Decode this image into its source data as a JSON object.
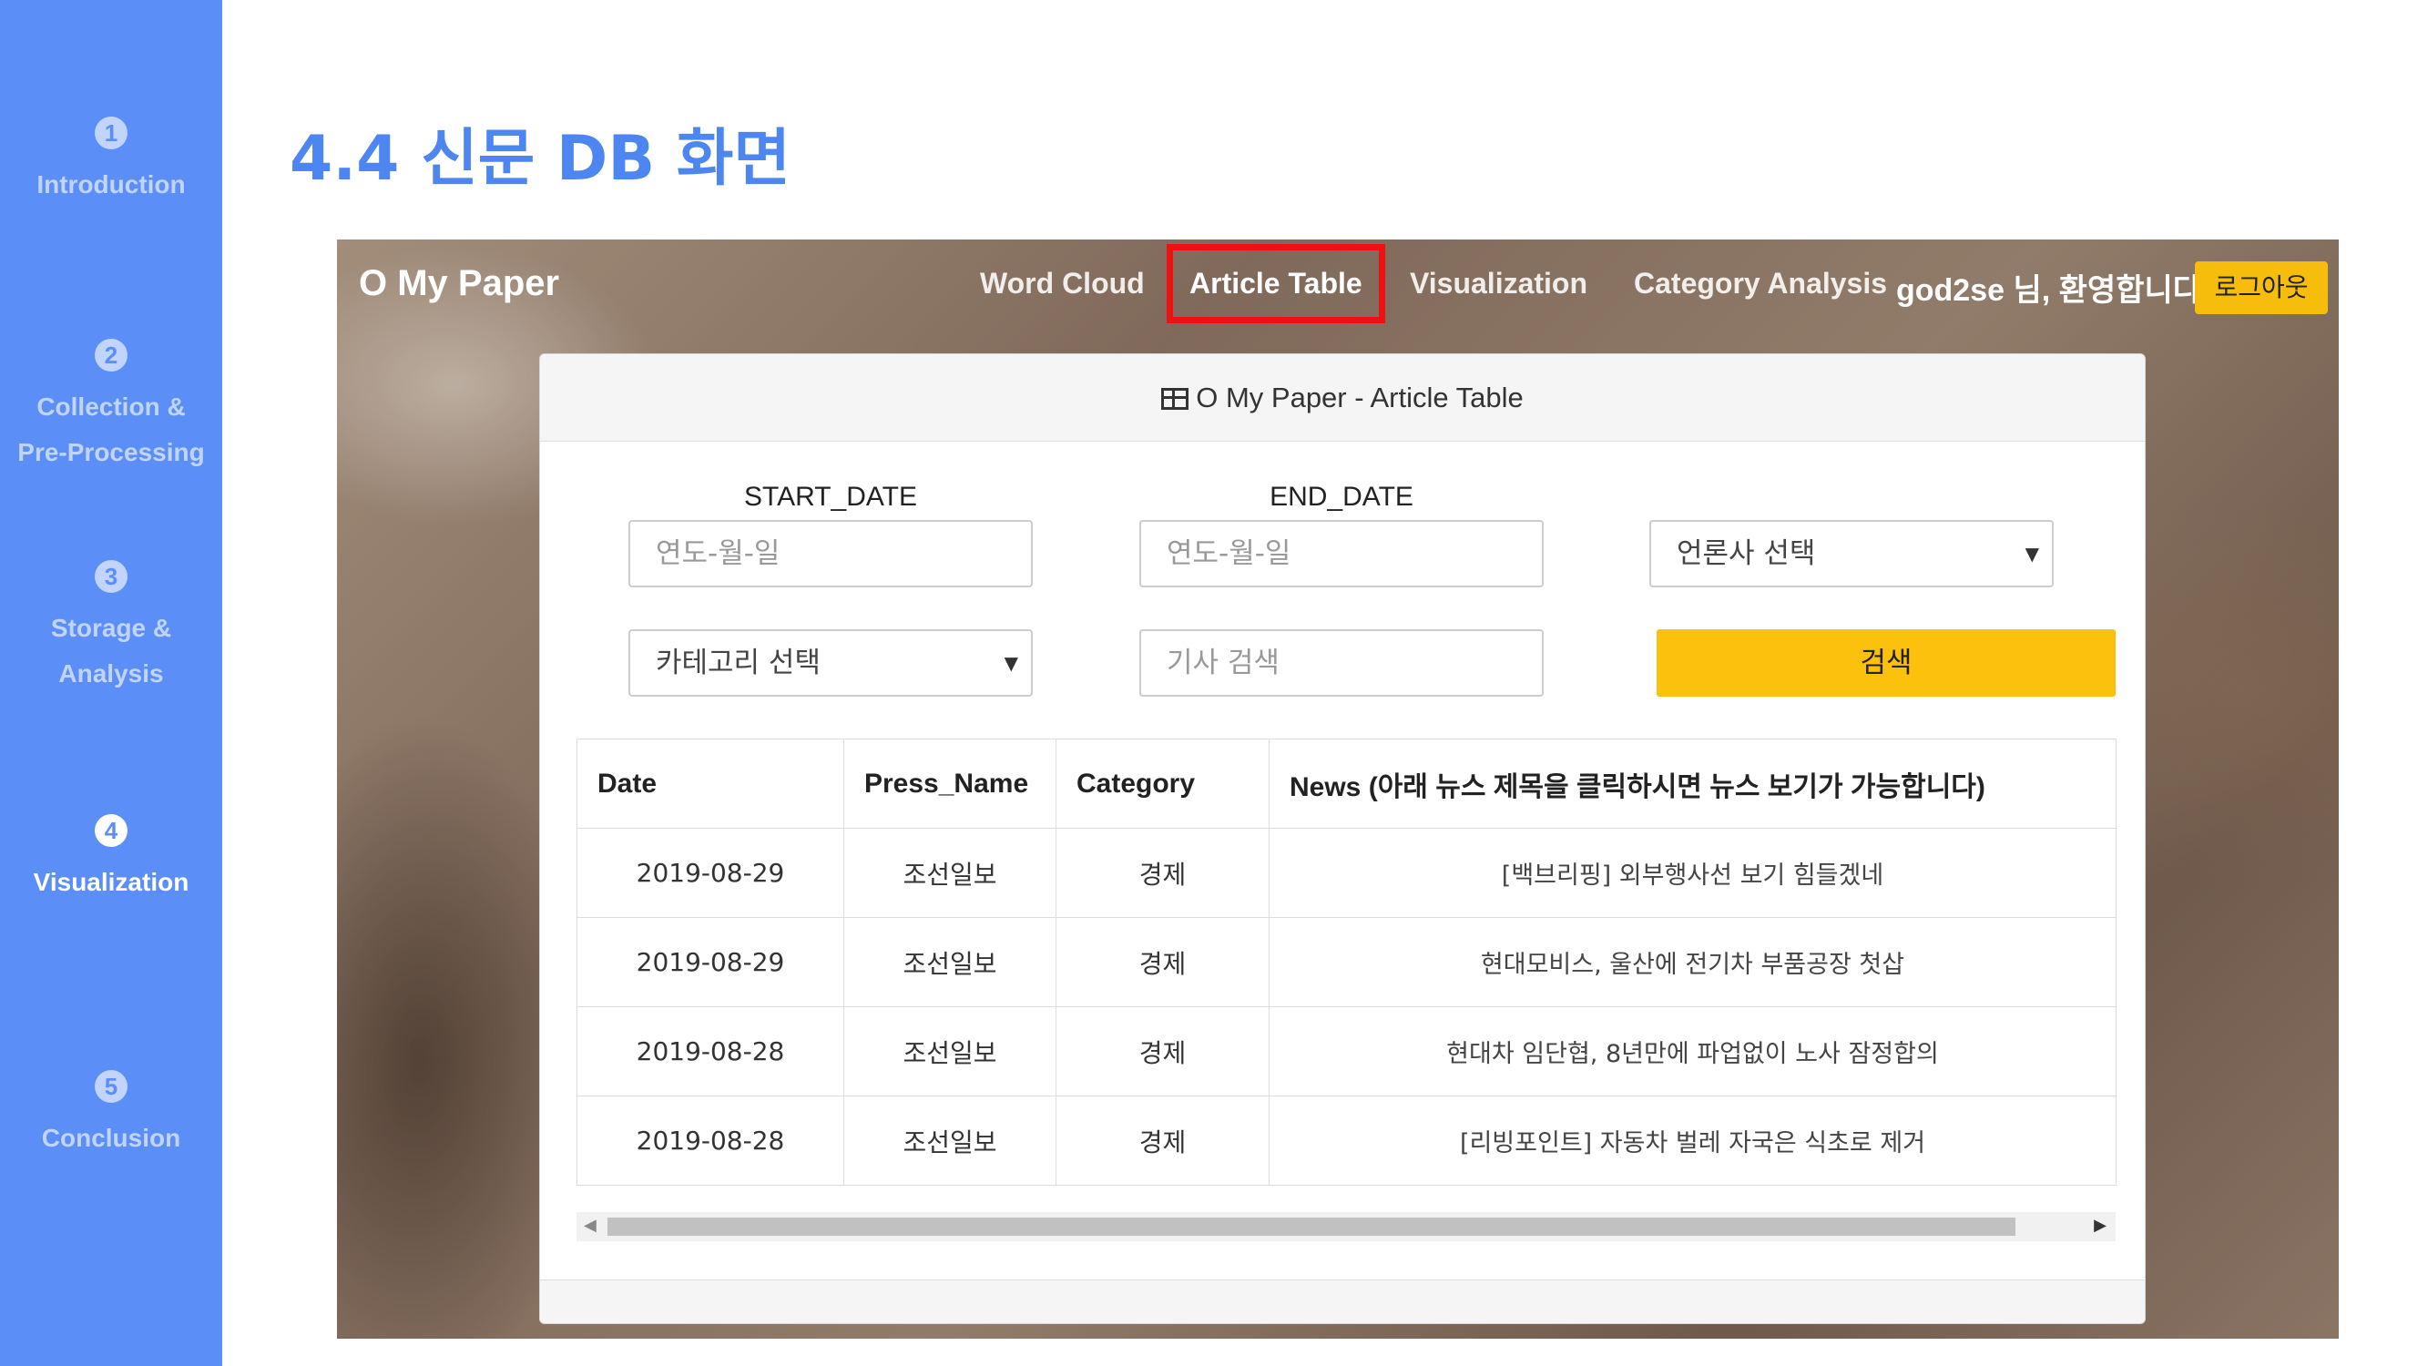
{
  "slide": {
    "title": "4.4 신문 DB 화면",
    "nav": [
      {
        "num": "1",
        "label": "Introduction"
      },
      {
        "num": "2",
        "label": "Collection &\nPre-Processing"
      },
      {
        "num": "3",
        "label": "Storage &\nAnalysis"
      },
      {
        "num": "4",
        "label": "Visualization",
        "active": true
      },
      {
        "num": "5",
        "label": "Conclusion"
      }
    ],
    "accent_color": "#5b8ff7",
    "highlight_color": "#ee1111"
  },
  "app": {
    "brand": "O My Paper",
    "menu": [
      "Word Cloud",
      "Article Table",
      "Visualization",
      "Category Analysis"
    ],
    "active_menu": "Article Table",
    "welcome": "god2se 님, 환영합니다.",
    "logout_label": "로그아웃",
    "panel_title": "O My Paper - Article Table",
    "filters": {
      "start_label": "START_DATE",
      "start_placeholder": "연도-월-일",
      "end_label": "END_DATE",
      "end_placeholder": "연도-월-일",
      "press_select": "언론사 선택",
      "category_select": "카테고리 선택",
      "search_placeholder": "기사 검색",
      "search_button": "검색"
    },
    "table": {
      "headers": [
        "Date",
        "Press_Name",
        "Category",
        "News (아래 뉴스 제목을 클릭하시면 뉴스 보기가 가능합니다)"
      ],
      "rows": [
        [
          "2019-08-29",
          "조선일보",
          "경제",
          "[백브리핑] 외부행사선 보기 힘들겠네"
        ],
        [
          "2019-08-29",
          "조선일보",
          "경제",
          "현대모비스, 울산에 전기차 부품공장 첫삽"
        ],
        [
          "2019-08-28",
          "조선일보",
          "경제",
          "현대차 임단협, 8년만에 파업없이 노사 잠정합의"
        ],
        [
          "2019-08-28",
          "조선일보",
          "경제",
          "[리빙포인트] 자동차 벌레 자국은 식초로 제거"
        ]
      ]
    },
    "button_color": "#fbc10d"
  }
}
